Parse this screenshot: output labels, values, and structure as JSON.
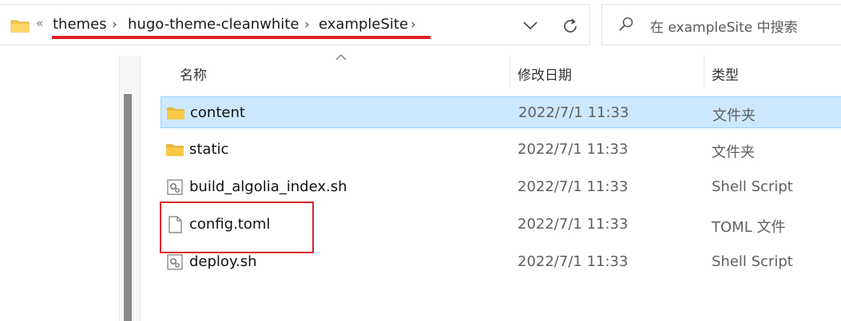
{
  "address": {
    "overflow_glyph": "«",
    "crumbs": [
      {
        "label": "themes",
        "sep": "›"
      },
      {
        "label": "hugo-theme-cleanwhite",
        "sep": "›"
      },
      {
        "label": "exampleSite",
        "sep": "›"
      }
    ],
    "icons": {
      "folder": "folder-icon",
      "dropdown": "chevron-down-icon",
      "refresh": "refresh-icon"
    }
  },
  "search": {
    "placeholder": "在 exampleSite 中搜索",
    "icon": "search-icon"
  },
  "columns": {
    "name": "名称",
    "date": "修改日期",
    "type": "类型"
  },
  "files": [
    {
      "name": "content",
      "date": "2022/7/1 11:33",
      "type": "文件夹",
      "icon": "folder-icon",
      "selected": true
    },
    {
      "name": "static",
      "date": "2022/7/1 11:33",
      "type": "文件夹",
      "icon": "folder-icon",
      "selected": false
    },
    {
      "name": "build_algolia_index.sh",
      "date": "2022/7/1 11:33",
      "type": "Shell Script",
      "icon": "script-file-icon",
      "selected": false
    },
    {
      "name": "config.toml",
      "date": "2022/7/1 11:33",
      "type": "TOML 文件",
      "icon": "document-file-icon",
      "selected": false,
      "highlighted": true
    },
    {
      "name": "deploy.sh",
      "date": "2022/7/1 11:33",
      "type": "Shell Script",
      "icon": "script-file-icon",
      "selected": false
    }
  ],
  "colors": {
    "selection_bg": "#cce8ff",
    "selection_border": "#99d1ff",
    "annotation_red": "#e01e24",
    "folder_yellow": "#f8c948"
  }
}
